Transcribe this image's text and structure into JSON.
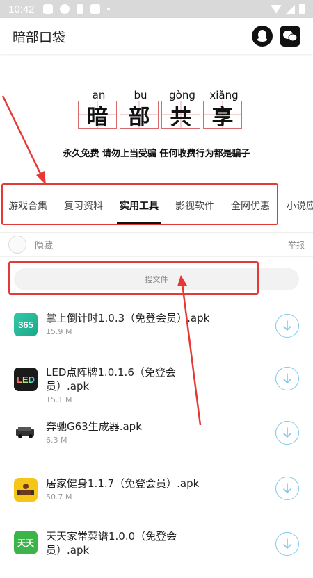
{
  "status_bar": {
    "time": "10:42"
  },
  "app_bar": {
    "title": "暗部口袋"
  },
  "banner": {
    "pinyin": [
      "an",
      "bu",
      "gòng",
      "xiǎng"
    ],
    "characters": [
      "暗",
      "部",
      "共",
      "享"
    ],
    "slogan": "永久免费 请勿上当受骗 任何收费行为都是骗子",
    "grid_color": "#d86a6a"
  },
  "tabs": [
    {
      "label": "游戏合集"
    },
    {
      "label": "复习资料"
    },
    {
      "label": "实用工具",
      "active": true
    },
    {
      "label": "影视软件"
    },
    {
      "label": "全网优惠"
    },
    {
      "label": "小说应"
    }
  ],
  "user_row": {
    "hide_label": "隐藏",
    "report_label": "举报"
  },
  "search": {
    "placeholder": "搜文件"
  },
  "files": [
    {
      "name": "掌上倒计时1.0.3（免登会员）.apk",
      "size": "15.9 M",
      "icon": "countdown-365-icon",
      "icon_text": "365"
    },
    {
      "name": "LED点阵牌1.0.1.6（免登会员）.apk",
      "size": "15.1 M",
      "icon": "led-icon",
      "icon_text": "LED"
    },
    {
      "name": "奔驰G63生成器.apk",
      "size": "6.3 M",
      "icon": "car-icon",
      "icon_text": ""
    },
    {
      "name": "居家健身1.1.7（免登会员）.apk",
      "size": "50.7 M",
      "icon": "fitness-icon",
      "icon_text": ""
    },
    {
      "name": "天天家常菜谱1.0.0（免登会员）.apk",
      "size": "",
      "icon": "recipe-icon",
      "icon_text": "天天"
    }
  ],
  "colors": {
    "annotation_red": "#e53935",
    "download_blue": "#7ec8ef",
    "active_tab": "#111111"
  }
}
